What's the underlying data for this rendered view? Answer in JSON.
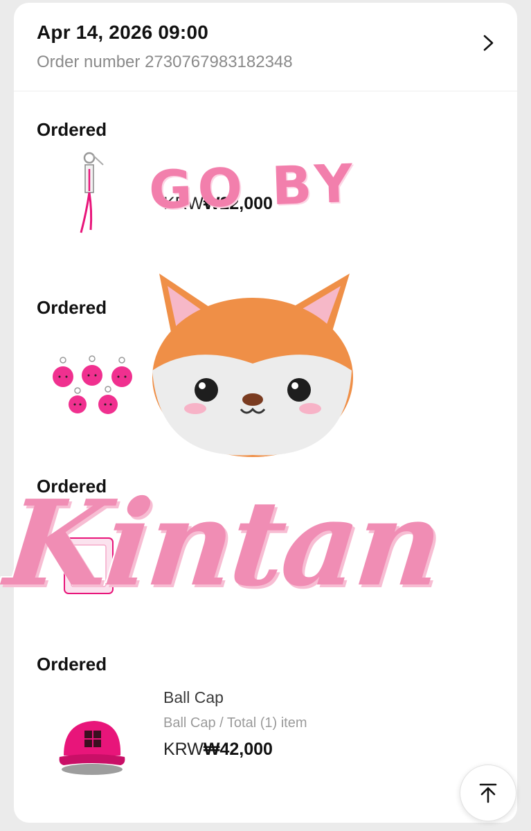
{
  "order": {
    "date": "Apr 14, 2026 09:00",
    "number_label": "Order number",
    "number": "2730767983182348"
  },
  "items": [
    {
      "status": "Ordered",
      "name": "",
      "options": "",
      "currency": "KRW",
      "price": "₩22,000"
    },
    {
      "status": "Ordered",
      "name": "",
      "options": "",
      "currency": "",
      "price": ""
    },
    {
      "status": "Ordered",
      "name": "",
      "options": "",
      "currency": "",
      "price": ""
    },
    {
      "status": "Ordered",
      "name": "Ball Cap",
      "options": "Ball Cap / Total (1) item",
      "currency": "KRW",
      "price": "₩42,000"
    }
  ],
  "watermarks": {
    "top_text": "GO BY",
    "bottom_text": "Kintan"
  },
  "icons": {
    "details": "chevron-right-icon",
    "scroll_top": "arrow-up-to-top-icon"
  },
  "colors": {
    "product_pink": "#e8157a",
    "watermark_pink": "#f08db4",
    "fox_orange": "#ef8f47"
  }
}
